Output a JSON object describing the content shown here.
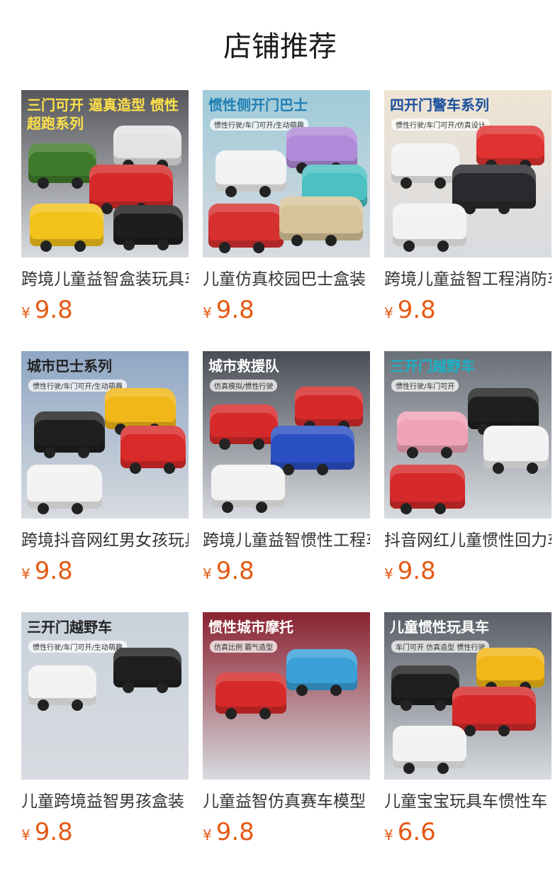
{
  "page_title": "店铺推荐",
  "currency": "¥",
  "products": [
    {
      "name": "跨境儿童益智盒装玩具车",
      "price": "9.8",
      "banner": "三门可开 逼真造型 惯性超跑系列",
      "sub": "",
      "bg": "#56575c",
      "banner_color": "#ffe14a",
      "toys": [
        "#3f7a2a",
        "#e3e3e3",
        "#d62a2a",
        "#f2c21a",
        "#1d1d1d"
      ]
    },
    {
      "name": "儿童仿真校园巴士盒装",
      "price": "9.8",
      "banner": "惯性侧开门巴士",
      "sub": "惯性行驶/车门可开/生动萌趣",
      "bg": "#9ecad8",
      "banner_color": "#1f7fb4",
      "toys": [
        "#f2f2f2",
        "#b08ad8",
        "#4cc0c2",
        "#d63030",
        "#d8c49a"
      ]
    },
    {
      "name": "跨境儿童益智工程消防车",
      "price": "9.8",
      "banner": "四开门警车系列",
      "sub": "惯性行驶/车门可开/仿真设计",
      "bg": "#efe4d4",
      "banner_color": "#1b4f9c",
      "toys": [
        "#f2f2f2",
        "#e03232",
        "#2a2a2e",
        "#f2f2f2"
      ]
    },
    {
      "name": "跨境抖音网红男女孩玩具",
      "price": "9.8",
      "banner": "城市巴士系列",
      "sub": "惯性行驶/车门可开/生动萌趣",
      "bg": "#8fa6c4",
      "banner_color": "#222222",
      "toys": [
        "#1f1f1f",
        "#f1b617",
        "#d92a2a",
        "#f2f2f2"
      ]
    },
    {
      "name": "跨境儿童益智惯性工程车",
      "price": "9.8",
      "banner": "城市救援队",
      "sub": "仿真模拟/惯性行驶",
      "bg": "#4a4d55",
      "banner_color": "#ffffff",
      "toys": [
        "#d62a2a",
        "#d62a2a",
        "#2a4fc2",
        "#f2f2f2"
      ]
    },
    {
      "name": "抖音网红儿童惯性回力车",
      "price": "9.8",
      "banner": "三开门越野车",
      "sub": "惯性行驶/车门可开",
      "bg": "#6a7078",
      "banner_color": "#1ab2c8",
      "toys": [
        "#f0a2b8",
        "#1f1f1f",
        "#f2f2f2",
        "#d62a2a"
      ]
    },
    {
      "name": "儿童跨境益智男孩盒装",
      "price": "9.8",
      "banner": "三开门越野车",
      "sub": "惯性行驶/车门可开/生动萌趣",
      "bg": "#c9d2dc",
      "banner_color": "#222222",
      "toys": [
        "#f2f2f2",
        "#1f1f1f"
      ]
    },
    {
      "name": "儿童益智仿真赛车模型",
      "price": "9.8",
      "banner": "惯性城市摩托",
      "sub": "仿真比例 霸气造型",
      "bg": "#8a2230",
      "banner_color": "#ffffff",
      "toys": [
        "#d62a2a",
        "#3aa0d8"
      ]
    },
    {
      "name": "儿童宝宝玩具车惯性车",
      "price": "6.6",
      "banner": "儿童惯性玩具车",
      "sub": "车门可开 仿真造型 惯性行驶",
      "bg": "#5a5e66",
      "banner_color": "#ffffff",
      "toys": [
        "#1f1f1f",
        "#f1b617",
        "#d62a2a",
        "#f2f2f2"
      ]
    }
  ]
}
